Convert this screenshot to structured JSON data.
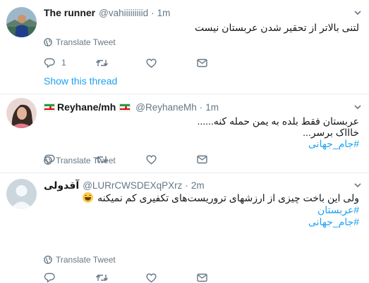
{
  "tweets": [
    {
      "name": "The runner",
      "handle": "@vahiiiiiiiiid",
      "dot": "·",
      "time": "1m",
      "text_lines": [
        "لتنی بالاتر از تحقیر شدن عربستان نیست"
      ],
      "translate_label": "Translate Tweet",
      "reply_count": "1",
      "show_thread": "Show this thread"
    },
    {
      "name": "Reyhane/mh",
      "handle": "@ReyhaneMh",
      "dot": "·",
      "time": "1m",
      "text_lines": [
        "عربستان فقط بلده به یمن حمله کنه......",
        "خاااک برسر..."
      ],
      "hashtags": [
        "#جام_جهانی"
      ],
      "translate_label": "Translate Tweet"
    },
    {
      "name": "آقدولی",
      "handle": "@LURrCWSDEXqPXrz",
      "dot": "·",
      "time": "2m",
      "text_lines": [
        "ولی این باخت چیزی از ارزشهای تروریست‌های تکفیری کم نمیکنه"
      ],
      "emoji": "grinning-face",
      "hashtags": [
        "#عربستان",
        "#جام_جهانی"
      ],
      "translate_label": "Translate Tweet"
    }
  ],
  "colors": {
    "link": "#1da1f2",
    "muted": "#657786",
    "text": "#14171a",
    "divider": "#e6ecf0"
  },
  "icons": [
    "globe-icon",
    "reply-icon",
    "retweet-icon",
    "like-icon",
    "message-icon",
    "chevron-down-icon"
  ]
}
